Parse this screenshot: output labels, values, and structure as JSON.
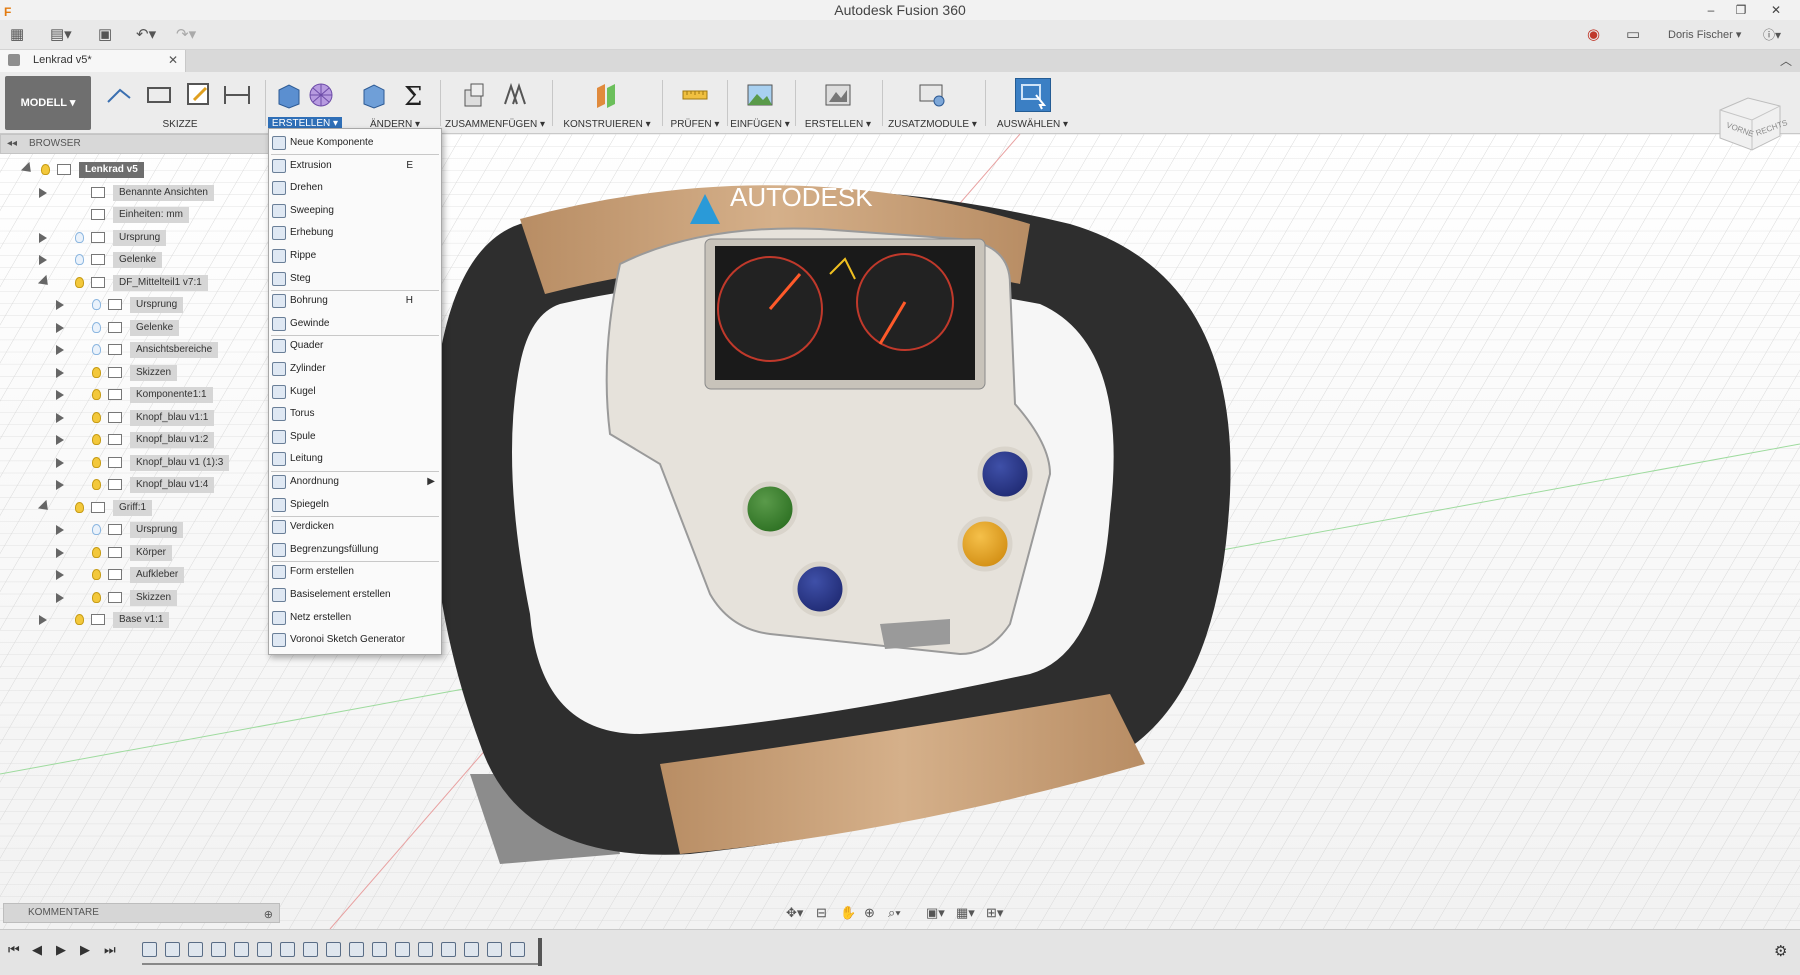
{
  "window": {
    "title": "Autodesk Fusion 360",
    "user": "Doris Fischer",
    "help": "?"
  },
  "doc_tab": {
    "name": "Lenkrad v5*"
  },
  "toolbar": {
    "workspace": "MODELL",
    "groups": [
      {
        "label": "SKIZZE"
      },
      {
        "label": "ERSTELLEN"
      },
      {
        "label": "ÄNDERN"
      },
      {
        "label": "ZUSAMMENFÜGEN"
      },
      {
        "label": "KONSTRUIEREN"
      },
      {
        "label": "PRÜFEN"
      },
      {
        "label": "EINFÜGEN"
      },
      {
        "label": "ERSTELLEN"
      },
      {
        "label": "ZUSATZMODULE"
      },
      {
        "label": "AUSWÄHLEN"
      }
    ]
  },
  "browser": {
    "title": "BROWSER",
    "items": [
      {
        "label": "Lenkrad v5",
        "level": 0,
        "bulb": "on"
      },
      {
        "label": "Benannte Ansichten",
        "level": 1,
        "bulb": "none"
      },
      {
        "label": "Einheiten: mm",
        "level": 1,
        "bulb": "none"
      },
      {
        "label": "Ursprung",
        "level": 1,
        "bulb": "off"
      },
      {
        "label": "Gelenke",
        "level": 1,
        "bulb": "off"
      },
      {
        "label": "DF_Mittelteil1 v7:1",
        "level": 1,
        "bulb": "on"
      },
      {
        "label": "Ursprung",
        "level": 2,
        "bulb": "off"
      },
      {
        "label": "Gelenke",
        "level": 2,
        "bulb": "off"
      },
      {
        "label": "Ansichtsbereiche",
        "level": 2,
        "bulb": "off"
      },
      {
        "label": "Skizzen",
        "level": 2,
        "bulb": "on"
      },
      {
        "label": "Komponente1:1",
        "level": 2,
        "bulb": "on"
      },
      {
        "label": "Knopf_blau v1:1",
        "level": 2,
        "bulb": "on"
      },
      {
        "label": "Knopf_blau v1:2",
        "level": 2,
        "bulb": "on"
      },
      {
        "label": "Knopf_blau v1 (1):3",
        "level": 2,
        "bulb": "on"
      },
      {
        "label": "Knopf_blau v1:4",
        "level": 2,
        "bulb": "on"
      },
      {
        "label": "Griff:1",
        "level": 1,
        "bulb": "on"
      },
      {
        "label": "Ursprung",
        "level": 2,
        "bulb": "off"
      },
      {
        "label": "Körper",
        "level": 2,
        "bulb": "on"
      },
      {
        "label": "Aufkleber",
        "level": 2,
        "bulb": "on"
      },
      {
        "label": "Skizzen",
        "level": 2,
        "bulb": "on"
      },
      {
        "label": "Base v1:1",
        "level": 1,
        "bulb": "on"
      }
    ]
  },
  "menu": {
    "items": [
      {
        "label": "Neue Komponente",
        "key": ""
      },
      {
        "label": "Extrusion",
        "key": "E"
      },
      {
        "label": "Drehen",
        "key": ""
      },
      {
        "label": "Sweeping",
        "key": ""
      },
      {
        "label": "Erhebung",
        "key": ""
      },
      {
        "label": "Rippe",
        "key": ""
      },
      {
        "label": "Steg",
        "key": ""
      },
      {
        "label": "Bohrung",
        "key": "H"
      },
      {
        "label": "Gewinde",
        "key": ""
      },
      {
        "label": "Quader",
        "key": ""
      },
      {
        "label": "Zylinder",
        "key": ""
      },
      {
        "label": "Kugel",
        "key": ""
      },
      {
        "label": "Torus",
        "key": ""
      },
      {
        "label": "Spule",
        "key": ""
      },
      {
        "label": "Leitung",
        "key": ""
      },
      {
        "label": "Anordnung",
        "key": ""
      },
      {
        "label": "Spiegeln",
        "key": ""
      },
      {
        "label": "Verdicken",
        "key": ""
      },
      {
        "label": "Begrenzungsfüllung",
        "key": ""
      },
      {
        "label": "Form erstellen",
        "key": ""
      },
      {
        "label": "Basiselement erstellen",
        "key": ""
      },
      {
        "label": "Netz erstellen",
        "key": ""
      },
      {
        "label": "Voronoi Sketch Generator",
        "key": ""
      }
    ]
  },
  "viewport": {
    "logo": "AUTODESK",
    "viewcube": {
      "front": "VORNE",
      "right": "RECHTS"
    }
  },
  "comments": {
    "title": "KOMMENTARE"
  },
  "colors": {
    "accent": "#2f6fb7",
    "wood": "#c9a27a",
    "grip": "#2e2e2e",
    "body": "#e6e2db"
  }
}
